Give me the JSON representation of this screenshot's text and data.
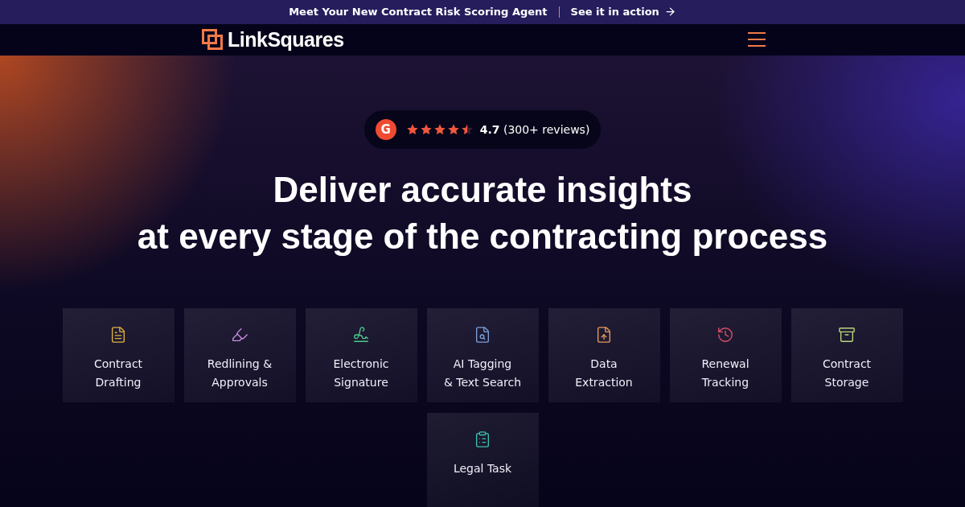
{
  "announcement": {
    "text": "Meet Your New Contract Risk Scoring Agent",
    "link": "See it in action"
  },
  "nav": {
    "brand": "LinkSquares"
  },
  "rating": {
    "badge": "G",
    "score": "4.7",
    "reviews": "(300+ reviews)",
    "stars": 4.5
  },
  "headline": [
    "Deliver accurate insights",
    "at every stage of the contracting process"
  ],
  "features": [
    {
      "lines": [
        "Contract",
        "Drafting"
      ],
      "color": "#e0b040"
    },
    {
      "lines": [
        "Redlining &",
        "Approvals"
      ],
      "color": "#c88ee0"
    },
    {
      "lines": [
        "Electronic",
        "Signature"
      ],
      "color": "#4ec98a"
    },
    {
      "lines": [
        "AI Tagging",
        "& Text Search"
      ],
      "color": "#7c9fd8"
    },
    {
      "lines": [
        "Data",
        "Extraction"
      ],
      "color": "#e8995a"
    },
    {
      "lines": [
        "Renewal",
        "Tracking"
      ],
      "color": "#e0506a"
    },
    {
      "lines": [
        "Contract",
        "Storage"
      ],
      "color": "#b8d878"
    },
    {
      "lines": [
        "Legal Task"
      ],
      "color": "#3cc0b0"
    }
  ]
}
